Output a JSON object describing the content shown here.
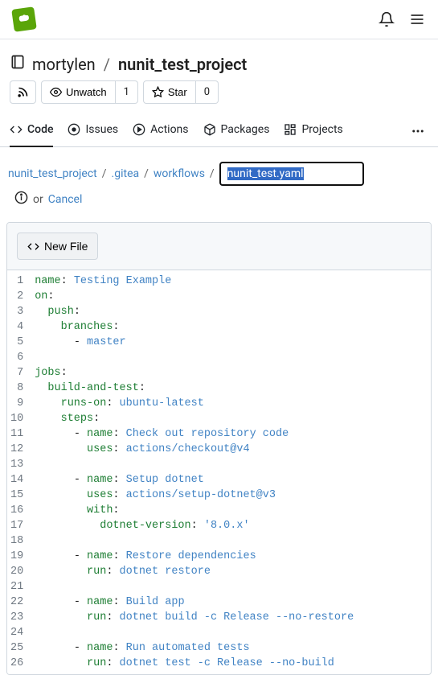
{
  "header": {
    "owner": "mortylen",
    "repo": "nunit_test_project"
  },
  "repo_actions": {
    "unwatch": "Unwatch",
    "watch_count": "1",
    "star": "Star",
    "star_count": "0"
  },
  "tabs": {
    "code": "Code",
    "issues": "Issues",
    "actions": "Actions",
    "packages": "Packages",
    "projects": "Projects"
  },
  "breadcrumb": {
    "root": "nunit_test_project",
    "gitea": ".gitea",
    "workflows": "workflows",
    "filename": "nunit_test.yaml",
    "or": "or",
    "cancel": "Cancel"
  },
  "editor": {
    "tab_label": "New File"
  },
  "code": [
    {
      "n": 1,
      "html": "<span class='tok-key'>name</span>: <span class='tok-str'>Testing Example</span>"
    },
    {
      "n": 2,
      "html": "<span class='tok-key'>on</span>:"
    },
    {
      "n": 3,
      "html": "  <span class='tok-key'>push</span>:"
    },
    {
      "n": 4,
      "html": "    <span class='tok-key'>branches</span>:"
    },
    {
      "n": 5,
      "html": "      <span class='tok-dash'>-</span> <span class='tok-str'>master</span>"
    },
    {
      "n": 6,
      "html": ""
    },
    {
      "n": 7,
      "html": "<span class='tok-key'>jobs</span>:"
    },
    {
      "n": 8,
      "html": "  <span class='tok-key'>build-and-test</span>:"
    },
    {
      "n": 9,
      "html": "    <span class='tok-key'>runs-on</span>: <span class='tok-str'>ubuntu-latest</span>"
    },
    {
      "n": 10,
      "html": "    <span class='tok-key'>steps</span>:"
    },
    {
      "n": 11,
      "html": "      <span class='tok-dash'>-</span> <span class='tok-key'>name</span>: <span class='tok-str'>Check out repository code</span>"
    },
    {
      "n": 12,
      "html": "        <span class='tok-key'>uses</span>: <span class='tok-str'>actions/checkout@v4</span>"
    },
    {
      "n": 13,
      "html": ""
    },
    {
      "n": 14,
      "html": "      <span class='tok-dash'>-</span> <span class='tok-key'>name</span>: <span class='tok-str'>Setup dotnet</span>"
    },
    {
      "n": 15,
      "html": "        <span class='tok-key'>uses</span>: <span class='tok-str'>actions/setup-dotnet@v3</span>"
    },
    {
      "n": 16,
      "html": "        <span class='tok-key'>with</span>:"
    },
    {
      "n": 17,
      "html": "          <span class='tok-key'>dotnet-version</span>: <span class='tok-str'>'8.0.x'</span>"
    },
    {
      "n": 18,
      "html": ""
    },
    {
      "n": 19,
      "html": "      <span class='tok-dash'>-</span> <span class='tok-key'>name</span>: <span class='tok-str'>Restore dependencies</span>"
    },
    {
      "n": 20,
      "html": "        <span class='tok-key'>run</span>: <span class='tok-str'>dotnet restore</span>"
    },
    {
      "n": 21,
      "html": ""
    },
    {
      "n": 22,
      "html": "      <span class='tok-dash'>-</span> <span class='tok-key'>name</span>: <span class='tok-str'>Build app</span>"
    },
    {
      "n": 23,
      "html": "        <span class='tok-key'>run</span>: <span class='tok-str'>dotnet build -c Release --no-restore</span>"
    },
    {
      "n": 24,
      "html": ""
    },
    {
      "n": 25,
      "html": "      <span class='tok-dash'>-</span> <span class='tok-key'>name</span>: <span class='tok-str'>Run automated tests</span>"
    },
    {
      "n": 26,
      "html": "        <span class='tok-key'>run</span>: <span class='tok-str'>dotnet test -c Release --no-build</span>"
    }
  ]
}
